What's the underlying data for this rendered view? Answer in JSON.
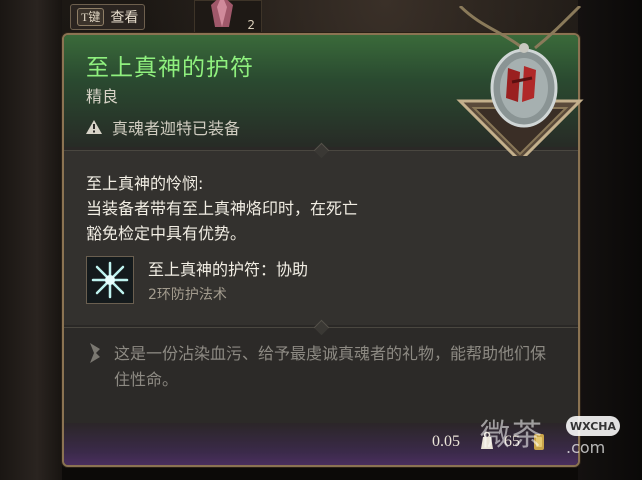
{
  "topbar": {
    "key": "T键",
    "action": "查看",
    "stack_count": "2"
  },
  "item": {
    "name": "至上真神的护符",
    "rarity": "精良",
    "equipped_status": "真魂者迦特已装备"
  },
  "passive": {
    "title": "至上真神的怜悯:",
    "description_line1": "当装备者带有至上真神烙印时，在死亡",
    "description_line2": "豁免检定中具有优势。"
  },
  "spell": {
    "name": "至上真神的护符：协助",
    "subtitle": "2环防护法术"
  },
  "flavor": {
    "text": "这是一份沾染血污、给予最虔诚真魂者的礼物，能帮助他们保住性命。"
  },
  "footer": {
    "weight": "0.05",
    "price": "65"
  },
  "watermark": {
    "text": "微茶",
    "badge": "WXCHA",
    "domain": ".com"
  },
  "colors": {
    "item_name": "#8ff07e",
    "border": "#8b7352",
    "header_green": "#3a6a3a",
    "footer_purple": "#4a2f5e"
  },
  "icons": {
    "warning": "warning-triangle-icon",
    "spell": "radiant-star-icon",
    "flavor": "quill-icon",
    "weight": "weight-icon",
    "coin": "gold-coin-icon"
  }
}
